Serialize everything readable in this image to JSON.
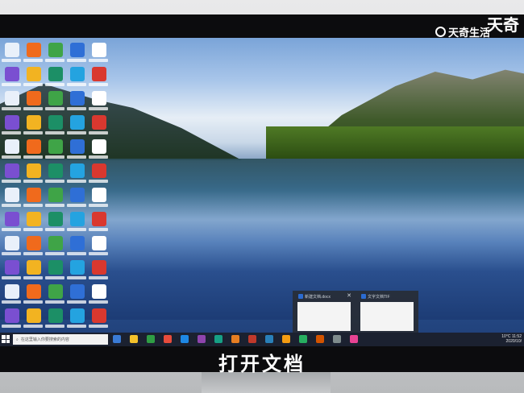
{
  "watermark": {
    "brand": "天奇生活",
    "corner_text": "天奇"
  },
  "taskbar": {
    "search_placeholder": "在这里输入你要搜索的内容",
    "tray_time": "11:52",
    "tray_date": "2020/10/",
    "tray_temp": "10°C"
  },
  "thumbnails": [
    {
      "title": "新建文档.docx"
    },
    {
      "title": "文字文档TIF"
    }
  ],
  "caption": "打开文档",
  "desktop_icon_count": 60,
  "colors": {
    "taskbar": "#1b2130",
    "bezel": "#0c0c0e",
    "accent": "#2b6bd1"
  }
}
